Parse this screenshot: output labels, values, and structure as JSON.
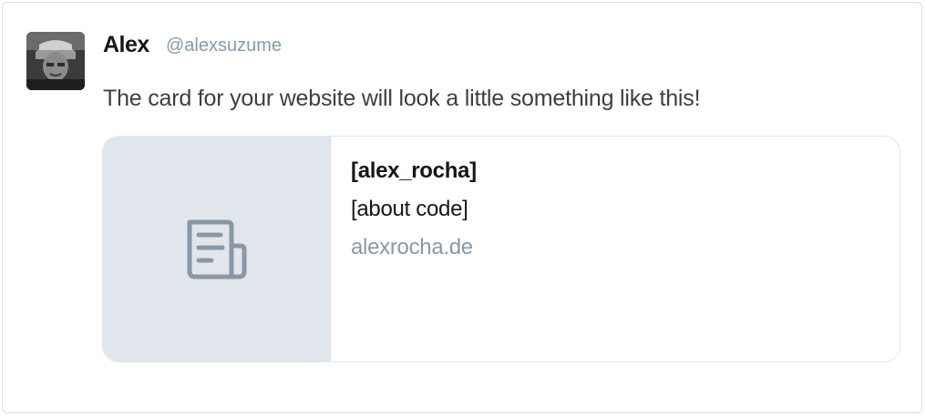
{
  "tweet": {
    "author_name": "Alex",
    "author_handle": "@alexsuzume",
    "text": "The card for your website will look a little something like this!"
  },
  "card": {
    "image_icon": "document-icon",
    "title": "[alex_rocha]",
    "description": "[about code]",
    "domain": "alexrocha.de"
  },
  "colors": {
    "text_primary": "#14171a",
    "text_secondary": "#8899a6",
    "card_image_bg": "#e1e6ec",
    "border": "#e1e8ed"
  }
}
